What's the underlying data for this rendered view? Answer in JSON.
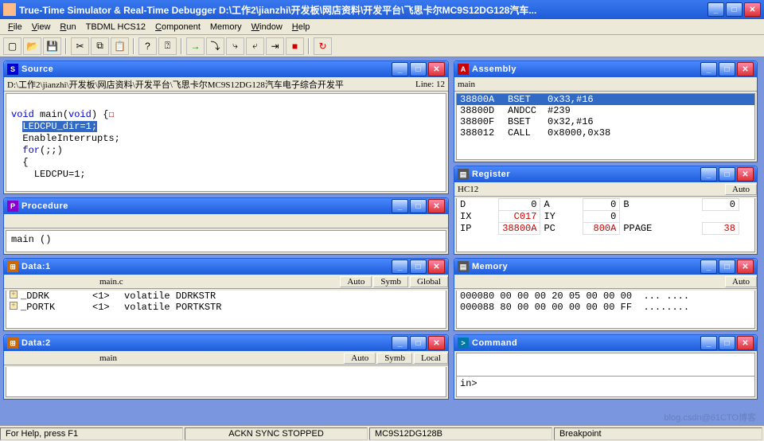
{
  "app": {
    "title": "True-Time Simulator & Real-Time Debugger   D:\\工作2\\jianzhi\\开发板\\网店资料\\开发平台\\飞思卡尔MC9S12DG128汽车..."
  },
  "menu": {
    "file": "File",
    "view": "View",
    "run": "Run",
    "tbdml": "TBDML HCS12",
    "component": "Component",
    "memory": "Memory",
    "window": "Window",
    "help": "Help"
  },
  "toolbar_icons": [
    "new",
    "open",
    "save",
    "cut",
    "copy",
    "paste",
    "help",
    "reset",
    "go",
    "step-over",
    "step-into",
    "step-out",
    "step-asm",
    "halt",
    "stop"
  ],
  "source": {
    "title": "Source",
    "path": "D:\\工作2\\jianzhi\\开发板\\网店资料\\开发平台\\飞思卡尔MC9S12DG128汽车电子综合开发平",
    "line_label": "Line: 12",
    "code": {
      "l1a": "void",
      "l1b": " main(",
      "l1c": "void",
      "l1d": ") {",
      "l2": "LEDCPU_dir=1;",
      "l3": "  EnableInterrupts;",
      "l4a": "for",
      "l4b": "(;;)",
      "l5": "{",
      "l6": "    LEDCPU=1;"
    }
  },
  "procedure": {
    "title": "Procedure",
    "item": "main ()"
  },
  "data1": {
    "title": "Data:1",
    "scope": "main.c",
    "mode1": "Auto",
    "mode2": "Symb",
    "mode3": "Global",
    "rows": [
      {
        "name": "_DDRK",
        "val": "<1>",
        "type": "volatile DDRKSTR"
      },
      {
        "name": "_PORTK",
        "val": "<1>",
        "type": "volatile PORTKSTR"
      }
    ]
  },
  "data2": {
    "title": "Data:2",
    "scope": "main",
    "mode1": "Auto",
    "mode2": "Symb",
    "mode3": "Local"
  },
  "assembly": {
    "title": "Assembly",
    "label": "main",
    "lines": [
      {
        "addr": "38800A",
        "mnem": "BSET",
        "ops": "0x33,#16",
        "sel": true
      },
      {
        "addr": "38800D",
        "mnem": "ANDCC",
        "ops": "#239",
        "sel": false
      },
      {
        "addr": "38800F",
        "mnem": "BSET",
        "ops": "0x32,#16",
        "sel": false
      },
      {
        "addr": "388012",
        "mnem": "CALL",
        "ops": "0x8000,0x38",
        "sel": false
      }
    ]
  },
  "register": {
    "title": "Register",
    "cpu": "HC12",
    "mode": "Auto",
    "D": "0",
    "A": "0",
    "B": "0",
    "IX": "C017",
    "IY": "0",
    "IP": "38800A",
    "PC": "800A",
    "PPAGE": "38"
  },
  "memory": {
    "title": "Memory",
    "mode": "Auto",
    "rows": [
      {
        "addr": "000080",
        "hex": "00 00 00 20 05 00 00 00",
        "asc": "... ...."
      },
      {
        "addr": "000088",
        "hex": "80 00 00 00 00 00 00 FF",
        "asc": "........"
      }
    ]
  },
  "command": {
    "title": "Command",
    "prompt": "in>"
  },
  "status": {
    "help": "For Help, press F1",
    "ackn": "ACKN SYNC STOPPED",
    "target": "MC9S12DG128B",
    "bp": "Breakpoint"
  },
  "watermark": "blog.csdn@61CTO博客"
}
